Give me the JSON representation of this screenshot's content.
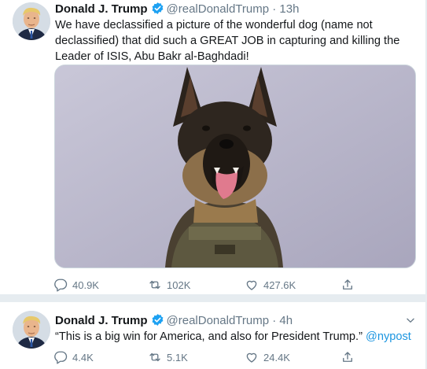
{
  "tweets": [
    {
      "author": "Donald J. Trump",
      "handle": "@realDonaldTrump",
      "separator": "·",
      "time": "13h",
      "text": "We have declassified a picture of the wonderful dog (name not declassified) that did such a GREAT JOB in capturing and killing the Leader of ISIS, Abu Bakr al-Baghdadi!",
      "media": "dog-photo",
      "replies": "40.9K",
      "retweets": "102K",
      "likes": "427.6K"
    },
    {
      "author": "Donald J. Trump",
      "handle": "@realDonaldTrump",
      "separator": "·",
      "time": "4h",
      "text": "“This is a big win for America, and also for President Trump.”",
      "mention": "@nypost",
      "replies": "4.4K",
      "retweets": "5.1K",
      "likes": "24.4K"
    }
  ],
  "icons": {
    "verified": "verified-badge-icon",
    "reply": "reply-icon",
    "retweet": "retweet-icon",
    "like": "heart-icon",
    "share": "share-icon",
    "caret": "chevron-down-icon"
  },
  "colors": {
    "verified": "#1da1f2",
    "muted": "#657786",
    "link": "#1b95e0",
    "separator_bg": "#e6ecf0"
  }
}
